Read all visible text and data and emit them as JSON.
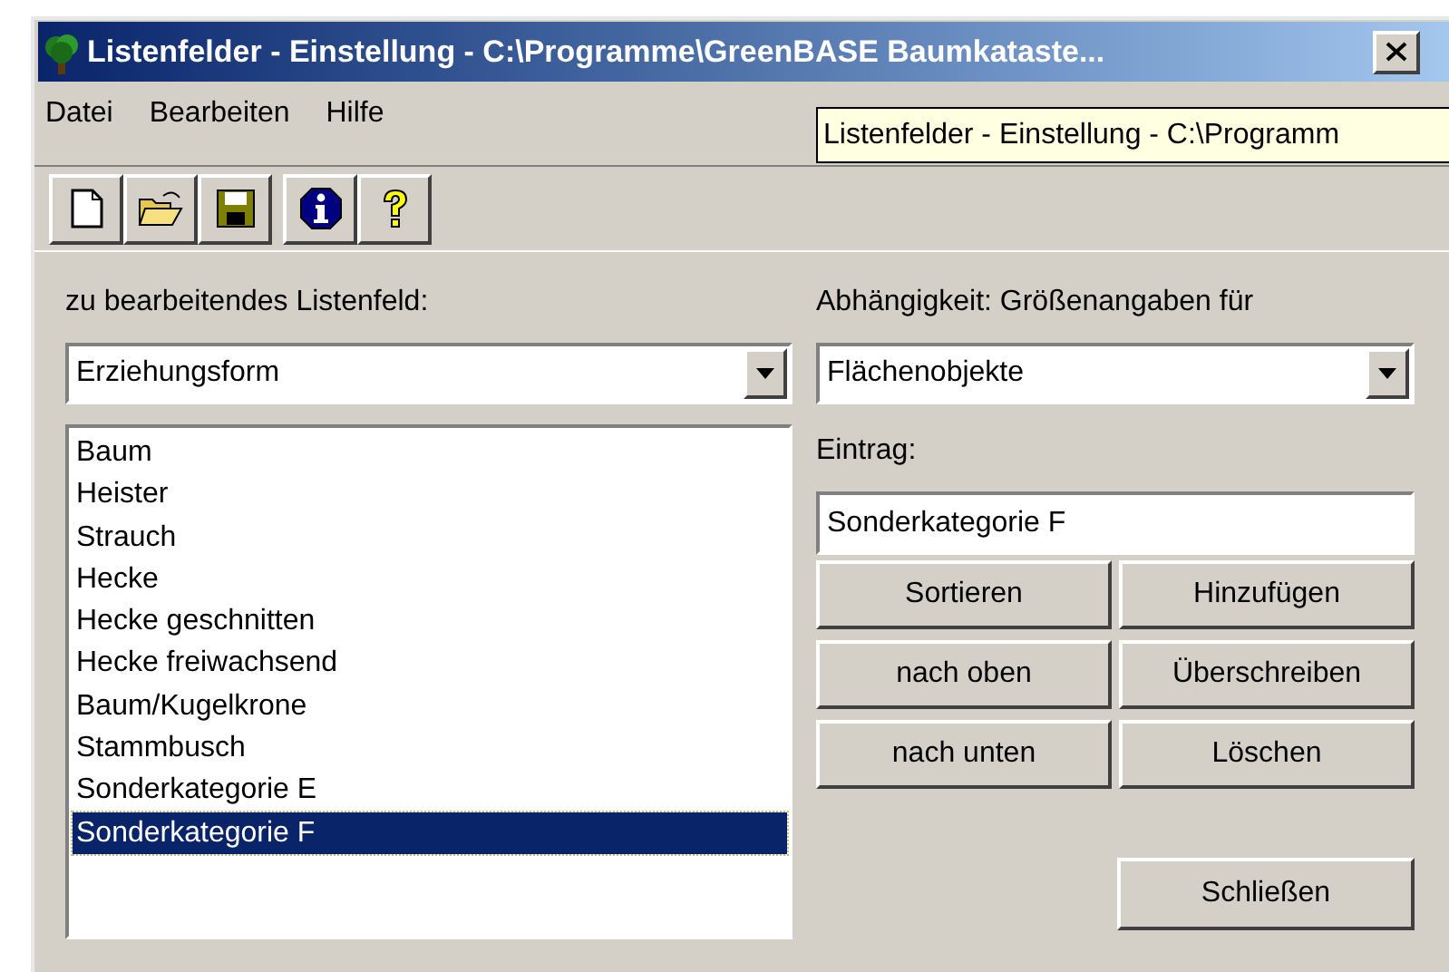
{
  "window": {
    "title": "Listenfelder - Einstellung - C:\\Programme\\GreenBASE Baumkataste..."
  },
  "tooltip": "Listenfelder - Einstellung - C:\\Programm",
  "menu": [
    "Datei",
    "Bearbeiten",
    "Hilfe"
  ],
  "toolbar": [
    {
      "kind": "new"
    },
    {
      "kind": "open"
    },
    {
      "kind": "save"
    },
    {
      "kind": "info"
    },
    {
      "kind": "help"
    }
  ],
  "left": {
    "label": "zu bearbeitendes Listenfeld:",
    "combo": "Erziehungsform",
    "items": [
      {
        "text": "Baum",
        "selected": false
      },
      {
        "text": "Heister",
        "selected": false
      },
      {
        "text": "Strauch",
        "selected": false
      },
      {
        "text": "Hecke",
        "selected": false
      },
      {
        "text": "Hecke geschnitten",
        "selected": false
      },
      {
        "text": "Hecke freiwachsend",
        "selected": false
      },
      {
        "text": "Baum/Kugelkrone",
        "selected": false
      },
      {
        "text": "Stammbusch",
        "selected": false
      },
      {
        "text": "Sonderkategorie E",
        "selected": false
      },
      {
        "text": "Sonderkategorie F",
        "selected": true
      }
    ]
  },
  "right": {
    "dependency_label": "Abhängigkeit: Größenangaben für",
    "combo": "Flächenobjekte",
    "entry_label": "Eintrag:",
    "entry_value": "Sonderkategorie F",
    "buttons": [
      {
        "label": "Sortieren"
      },
      {
        "label": "Hinzufügen"
      },
      {
        "label": "nach oben"
      },
      {
        "label": "Überschreiben"
      },
      {
        "label": "nach unten"
      },
      {
        "label": "Löschen"
      }
    ],
    "close_button": {
      "label": "Schließen"
    }
  }
}
